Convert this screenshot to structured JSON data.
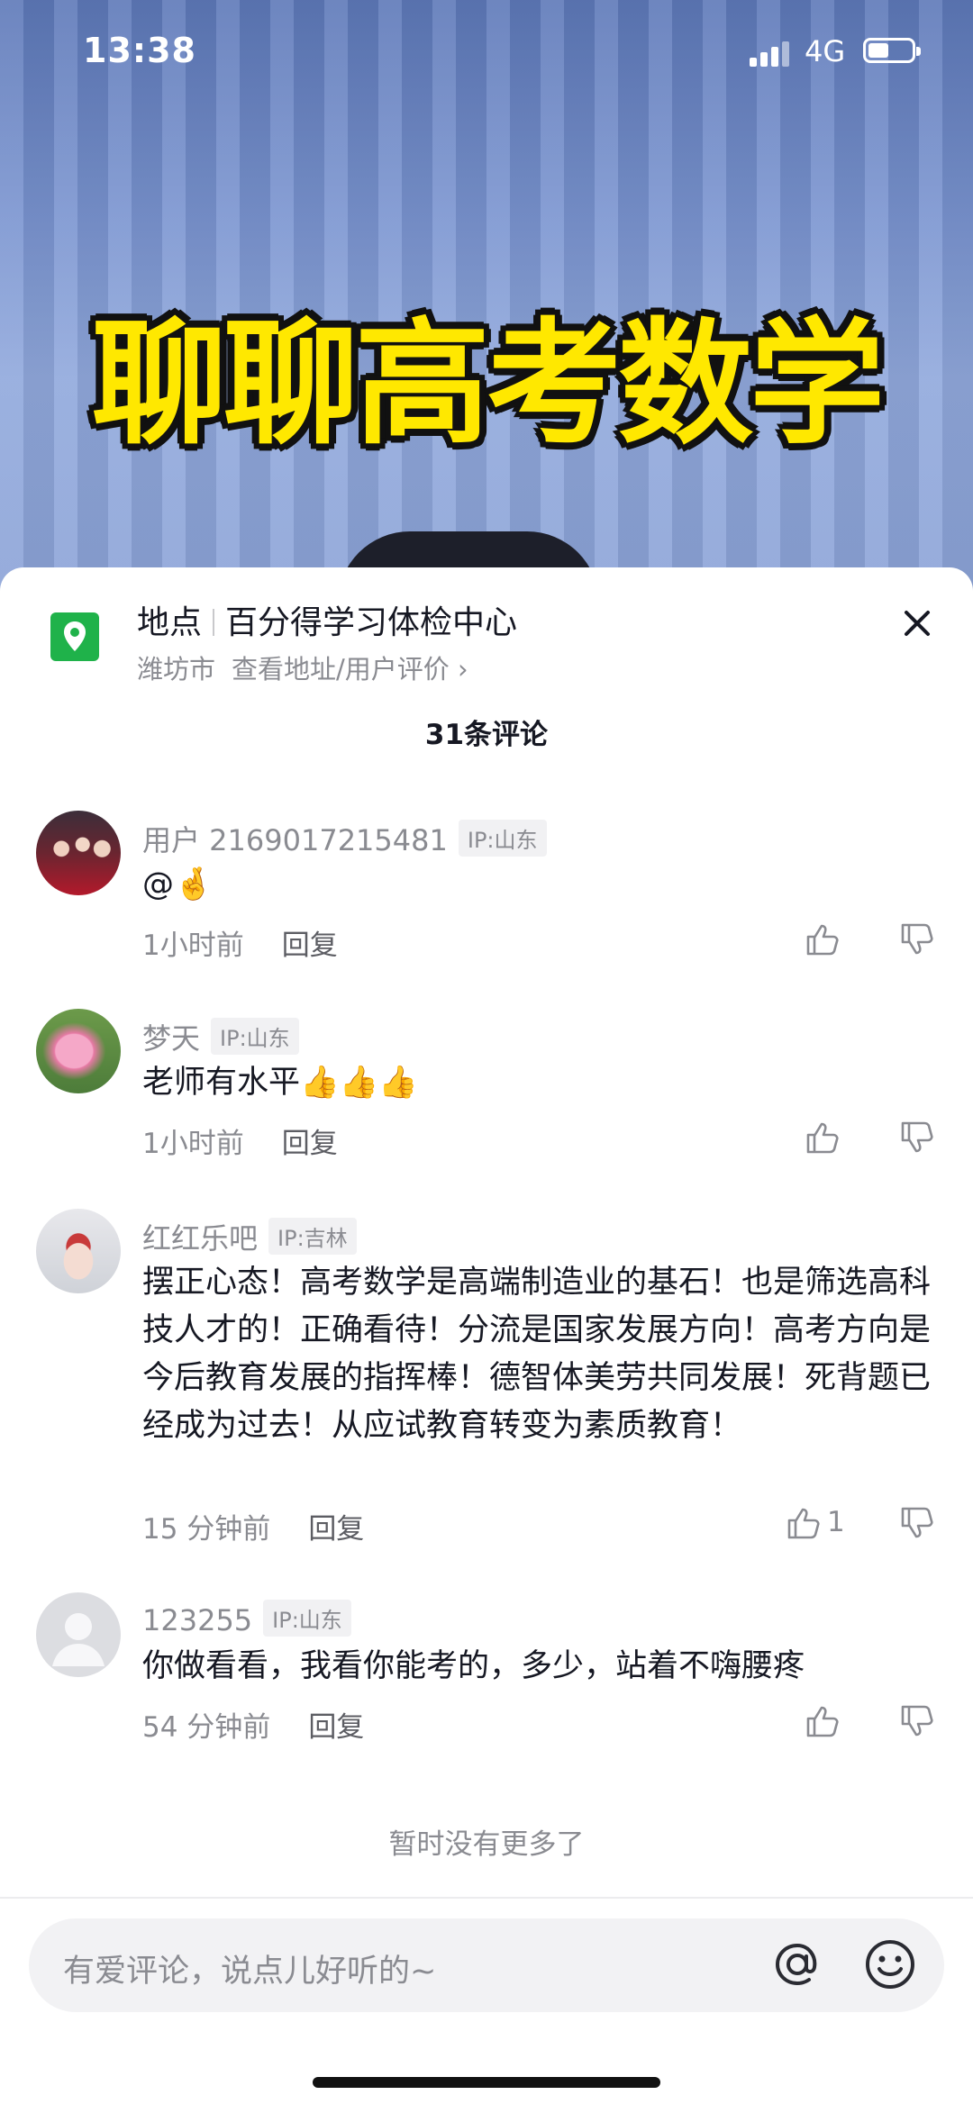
{
  "status": {
    "time": "13:38",
    "network": "4G"
  },
  "video": {
    "title": "聊聊高考数学"
  },
  "location": {
    "label": "地点",
    "name": "百分得学习体检中心",
    "city": "潍坊市",
    "link": "查看地址/用户评价 ›"
  },
  "comments_header": {
    "count_label": "31条评论"
  },
  "comments": [
    {
      "user": "用户 2169017215481",
      "ip": "IP:山东",
      "text": "@🤞",
      "time": "1小时前",
      "reply": "回复",
      "likes": ""
    },
    {
      "user": "梦天",
      "ip": "IP:山东",
      "text": "老师有水平👍👍👍",
      "time": "1小时前",
      "reply": "回复",
      "likes": ""
    },
    {
      "user": "红红乐吧",
      "ip": "IP:吉林",
      "text": "摆正心态！高考数学是高端制造业的基石！也是筛选高科技人才的！正确看待！分流是国家发展方向！高考方向是今后教育发展的指挥棒！德智体美劳共同发展！死背题已经成为过去！从应试教育转变为素质教育！",
      "time": "15 分钟前",
      "reply": "回复",
      "likes": "1"
    },
    {
      "user": "123255",
      "ip": "IP:山东",
      "text": "你做看看，我看你能考的，多少，站着不嗨腰疼",
      "time": "54 分钟前",
      "reply": "回复",
      "likes": ""
    }
  ],
  "footer": {
    "no_more": "暂时没有更多了",
    "input_placeholder": "有爱评论，说点儿好听的~"
  },
  "icons": [
    "location-pin-icon",
    "close-icon",
    "like-icon",
    "dislike-icon",
    "at-icon",
    "emoji-icon"
  ],
  "colors": {
    "accent_location": "#1fb24a",
    "title_yellow": "#ffe800",
    "text_primary": "#161823",
    "text_secondary": "#8a8b91"
  }
}
